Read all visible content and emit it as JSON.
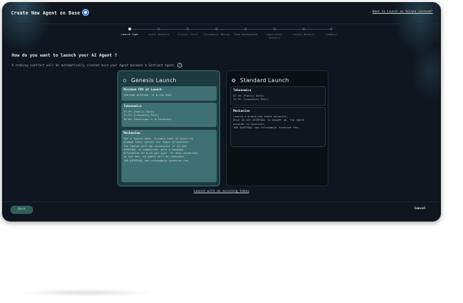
{
  "header": {
    "title": "Create New Agent on Base",
    "solana_link": "Want to Launch on Solana instead?"
  },
  "steps": [
    {
      "label": "Launch Type",
      "active": true
    },
    {
      "label": "Agent Details",
      "active": false
    },
    {
      "label": "Project Pitch",
      "active": false
    },
    {
      "label": "Tokenomics Design",
      "active": false
    },
    {
      "label": "Team Background",
      "active": false
    },
    {
      "label": "Additional Details",
      "active": false
    },
    {
      "label": "Launch Details",
      "active": false
    },
    {
      "label": "Summary",
      "active": false
    }
  ],
  "question": "How do you want to launch your AI Agent ?",
  "info_text": "A staking contract will be automatically created once your Agent becomes a Sentient Agent.",
  "genesis": {
    "title": "Genesis Launch",
    "fdv_title": "Minimum FDV at Launch",
    "fdv_value": "336,000 $VIRTUAL (£ 0.24k USD)",
    "tokenomics_title": "Tokenomics",
    "tokenomics_lines": [
      "37.5% (Public Sale)",
      "12.5% (Liquidity Pool)",
      "50.0% (Developer's Allocation)"
    ],
    "mechanism_title": "Mechanism",
    "mechanism_lines": [
      "Set a launch date. Virgens have 24 hours to",
      "pledge their points for token allocation.",
      "",
      "The launch will be successful if 42,425",
      "$VIRTUAL is committed, with a maximum",
      "allocation of 0.5% per user. If this condition",
      "is not met, no agent will be launched.",
      "",
      "100 $VIRTUAL non-refundable creation fee."
    ]
  },
  "standard": {
    "title": "Standard Launch",
    "tokenomics_title": "Tokenomics",
    "tokenomics_lines": [
      "87.5% (Public Sale)",
      "12.5% (Liquidity Pool)"
    ],
    "mechanism_title": "Mechanism",
    "mechanism_lines": [
      "Launch a brand new token directly.",
      "",
      "Once 42,425 $VIRTUAL is bought up, the agent",
      "ascends to Sentient.",
      "",
      "100 $VIRTUAL non-refundable creation fee."
    ]
  },
  "existing_token_link": "Launch with an existing token",
  "footer": {
    "next_label": "Next",
    "cancel_label": "Cancel"
  },
  "colors": {
    "background": "#0f1620",
    "genesis_card": "#1d3a40",
    "genesis_box": "#3f7073",
    "next_button": "#2f5f5d",
    "verified_badge": "#2a6fd6"
  }
}
